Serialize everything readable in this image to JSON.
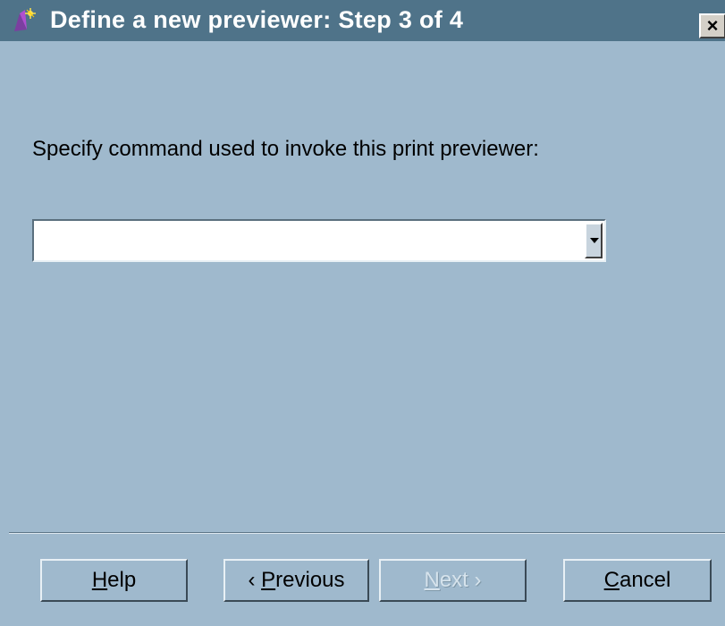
{
  "window": {
    "title": "Define a new previewer: Step 3 of 4",
    "close_label": "×"
  },
  "prompt": "Specify command used to invoke this print previewer:",
  "command_combo": {
    "value": ""
  },
  "buttons": {
    "help": {
      "mnemonic": "H",
      "rest": "elp"
    },
    "previous": {
      "arrow": "‹",
      "mnemonic": "P",
      "rest": "revious"
    },
    "next": {
      "mnemonic": "N",
      "rest": "ext",
      "arrow": "›"
    },
    "cancel": {
      "mnemonic": "C",
      "rest": "ancel"
    }
  },
  "colors": {
    "background": "#9fb9cd",
    "titlebar": "#4f7389"
  },
  "icons": {
    "title": "wizard-icon",
    "combo": "dropdown-arrow-icon"
  }
}
